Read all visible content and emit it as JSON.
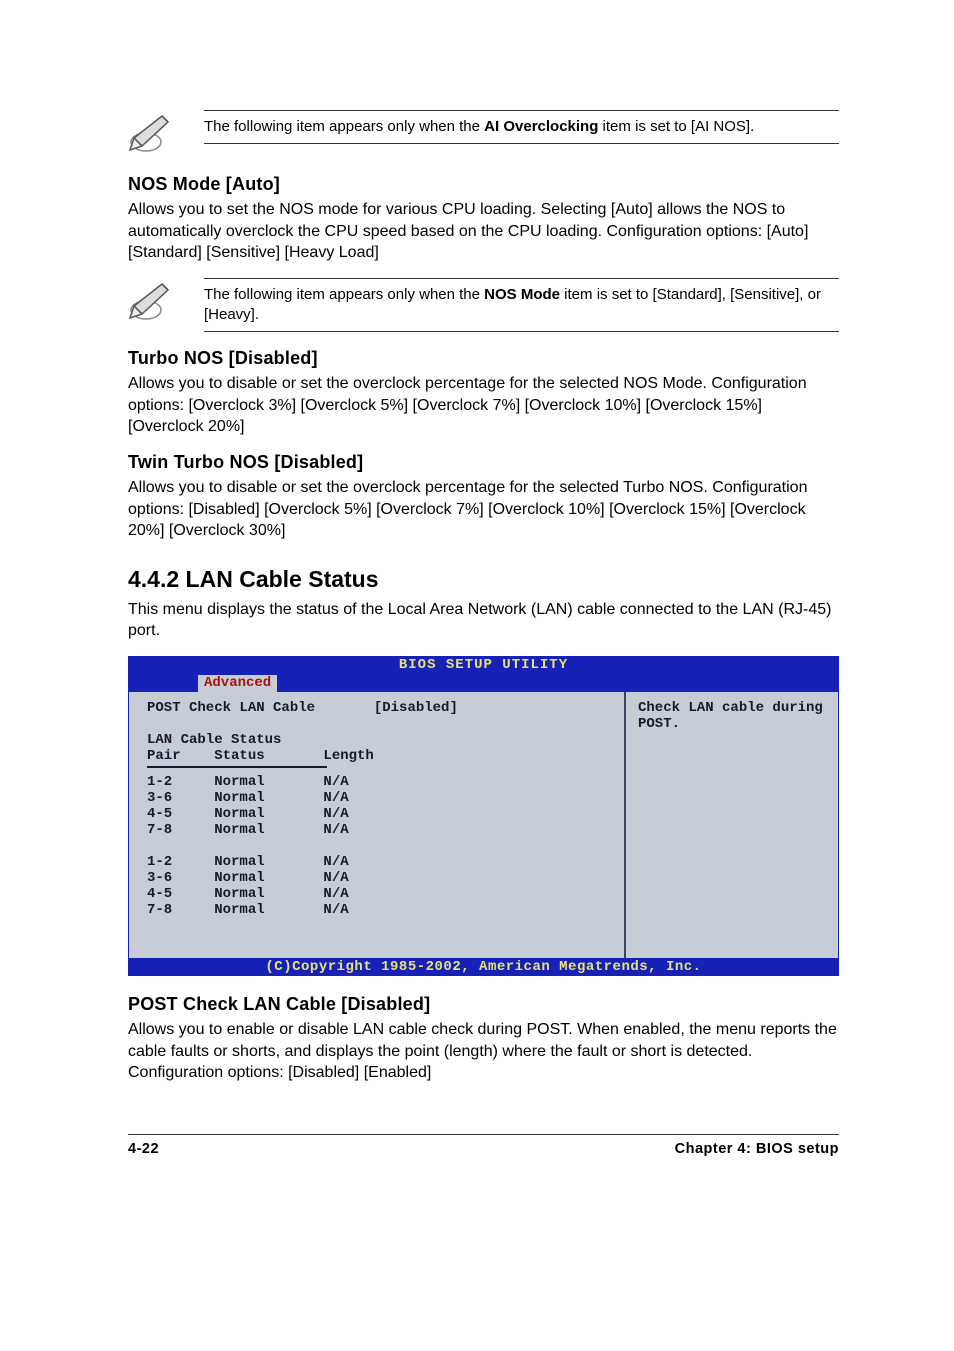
{
  "note1": {
    "prefix": "The following item appears only when the ",
    "bold": "AI Overclocking",
    "suffix": " item is set to [AI NOS]."
  },
  "sec1": {
    "heading": "NOS Mode [Auto]",
    "body": "Allows you to set the NOS mode for various CPU loading. Selecting [Auto] allows the NOS to automatically overclock the CPU speed based on the CPU loading. Configuration options: [Auto] [Standard] [Sensitive] [Heavy Load]"
  },
  "note2": {
    "prefix": "The following item appears only when the ",
    "bold": "NOS Mode",
    "suffix": " item is set to [Standard], [Sensitive], or [Heavy]."
  },
  "sec2": {
    "heading": "Turbo NOS [Disabled]",
    "body": "Allows you to disable or set the overclock percentage for the selected NOS Mode. Configuration options: [Overclock 3%] [Overclock 5%] [Overclock 7%] [Overclock 10%] [Overclock 15%] [Overclock 20%]"
  },
  "sec3": {
    "heading": "Twin Turbo NOS [Disabled]",
    "body": "Allows you to disable or set the overclock percentage for the selected Turbo NOS. Configuration options: [Disabled] [Overclock 5%] [Overclock 7%] [Overclock 10%] [Overclock 15%] [Overclock 20%] [Overclock 30%]"
  },
  "sec4": {
    "heading": "4.4.2   LAN Cable Status",
    "body": "This menu displays the status of the Local Area Network (LAN) cable connected to the LAN (RJ-45) port."
  },
  "bios": {
    "title": "BIOS SETUP UTILITY",
    "tab": "Advanced",
    "post_check_label": "POST Check LAN Cable",
    "post_check_value": "[Disabled]",
    "status_title": "LAN Cable Status",
    "headers": "Pair    Status       Length",
    "rows1": [
      "1-2     Normal       N/A",
      "3-6     Normal       N/A",
      "4-5     Normal       N/A",
      "7-8     Normal       N/A"
    ],
    "rows2": [
      "1-2     Normal       N/A",
      "3-6     Normal       N/A",
      "4-5     Normal       N/A",
      "7-8     Normal       N/A"
    ],
    "help": "Check LAN cable during POST.",
    "copyright": "(C)Copyright 1985-2002, American Megatrends, Inc."
  },
  "sec5": {
    "heading": "POST Check LAN Cable [Disabled]",
    "body": "Allows you to enable or disable LAN cable check during POST. When enabled, the menu reports the cable faults or shorts, and displays the point (length) where the fault or short is detected.",
    "config": "Configuration options: [Disabled] [Enabled]"
  },
  "footer": {
    "left": "4-22",
    "right": "Chapter 4: BIOS setup"
  }
}
